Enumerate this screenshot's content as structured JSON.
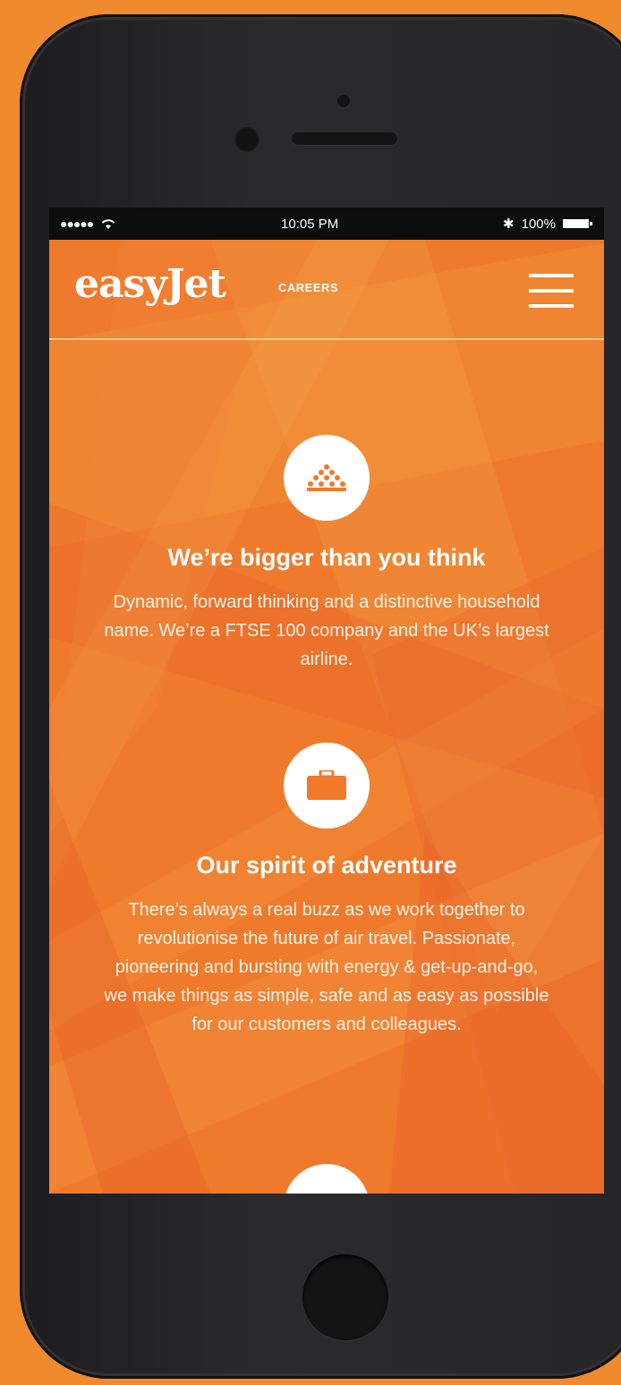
{
  "status_bar": {
    "signal": "●●●●●",
    "time": "10:05 PM",
    "bluetooth": "✱",
    "battery": "100%"
  },
  "header": {
    "logo": "easyJet",
    "subtitle": "CAREERS",
    "menu_icon": "hamburger-menu-icon"
  },
  "sections": [
    {
      "icon": "people-group-icon",
      "title": "We’re bigger than you think",
      "body": "Dynamic, forward thinking and a distinctive household name. We’re a FTSE 100 company and the UK’s largest airline."
    },
    {
      "icon": "suitcase-icon",
      "title": "Our spirit of adventure",
      "body": "There’s always a real buzz as we work together to revolutionise the future of air travel. Passionate, pioneering and bursting with energy & get-up-and-go, we make things as simple, safe and as easy as possible for our customers and colleagues."
    }
  ],
  "colors": {
    "brand_orange": "#ef7a2c",
    "background": "#f08a2e",
    "phone": "#262628",
    "icon_orange": "#f07a2a"
  }
}
